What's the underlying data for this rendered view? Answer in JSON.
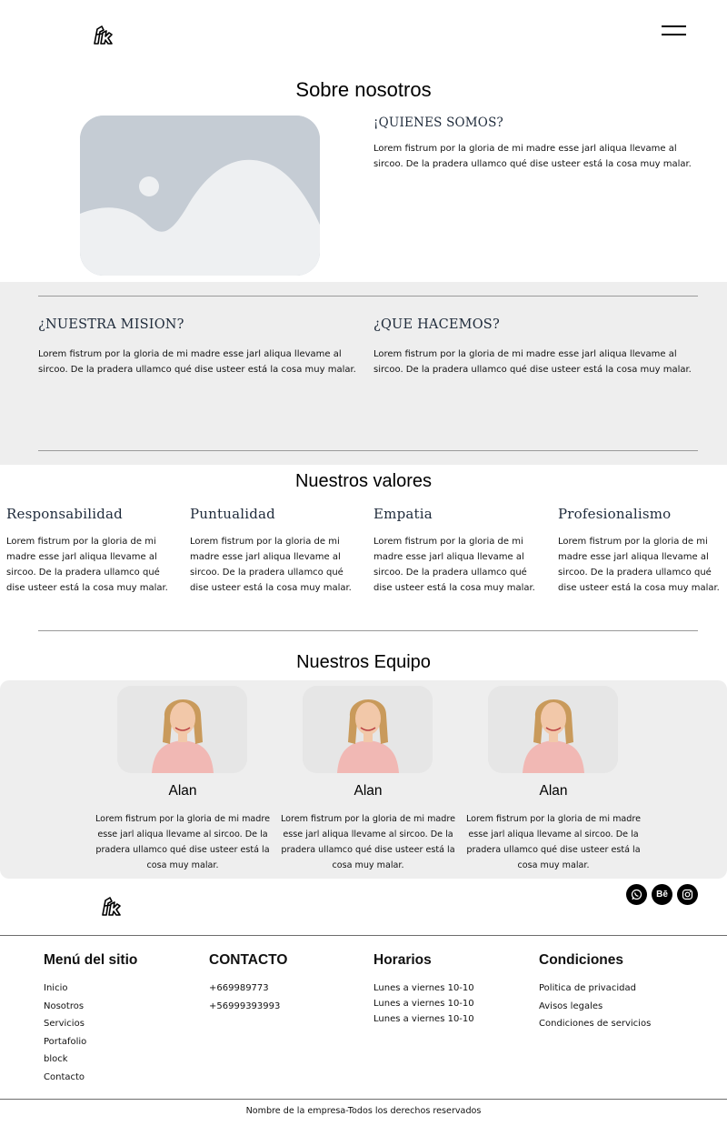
{
  "header": {
    "logo_icon": "brand-logo-icon",
    "menu_icon": "hamburger-menu-icon"
  },
  "about": {
    "title": "Sobre nosotros",
    "image_icon": "image-placeholder-icon",
    "who": {
      "heading": "¡QUIENES SOMOS?",
      "text": "Lorem fistrum por la gloria de mi madre esse jarl aliqua llevame al sircoo. De la pradera ullamco qué dise usteer está la cosa muy malar."
    },
    "mission": {
      "heading": "¿NUESTRA MISION?",
      "text": "Lorem fistrum por la gloria de mi madre esse jarl aliqua llevame al sircoo. De la pradera ullamco qué dise usteer está la cosa muy malar."
    },
    "what": {
      "heading": "¿QUE HACEMOS?",
      "text": "Lorem fistrum por la gloria de mi madre esse jarl aliqua llevame al sircoo. De la pradera ullamco qué dise usteer está la cosa muy malar."
    }
  },
  "values": {
    "title": "Nuestros valores",
    "items": [
      {
        "heading": "Responsabilidad",
        "text": "Lorem fistrum por la gloria de mi madre esse jarl aliqua llevame al sircoo. De la pradera ullamco qué dise usteer está la cosa muy malar."
      },
      {
        "heading": "Puntualidad",
        "text": "Lorem fistrum por la gloria de mi madre esse jarl aliqua llevame al sircoo. De la pradera ullamco qué dise usteer está la cosa muy malar."
      },
      {
        "heading": "Empatia",
        "text": "Lorem fistrum por la gloria de mi madre esse jarl aliqua llevame al sircoo. De la pradera ullamco qué dise usteer está la cosa muy malar."
      },
      {
        "heading": "Profesionalismo",
        "text": "Lorem fistrum por la gloria de mi madre esse jarl aliqua llevame al sircoo. De la pradera ullamco qué dise usteer está la cosa muy malar."
      }
    ]
  },
  "team": {
    "title": "Nuestros Equipo",
    "members": [
      {
        "name": "Alan",
        "text": "Lorem fistrum por la gloria de mi madre esse jarl aliqua llevame al sircoo. De la pradera ullamco qué dise usteer está la cosa muy malar."
      },
      {
        "name": "Alan",
        "text": "Lorem fistrum por la gloria de mi madre esse jarl aliqua llevame al sircoo. De la pradera ullamco qué dise usteer está la cosa muy malar."
      },
      {
        "name": "Alan",
        "text": "Lorem fistrum por la gloria de mi madre esse jarl aliqua llevame al sircoo. De la pradera ullamco qué dise usteer está la cosa muy malar."
      }
    ]
  },
  "social": {
    "whatsapp_icon": "whatsapp-icon",
    "behance_label": "Bē",
    "instagram_icon": "instagram-icon"
  },
  "footer": {
    "menu": {
      "heading": "Menú del sitio",
      "items": [
        "Inicio",
        "Nosotros",
        "Servicios",
        "Portafolio",
        "block",
        "Contacto"
      ]
    },
    "contact": {
      "heading": "CONTACTO",
      "items": [
        "+669989773",
        "+56999393993"
      ]
    },
    "hours": {
      "heading": "Horarios",
      "items": [
        "Lunes a viernes 10-10",
        "Lunes a viernes 10-10",
        "Lunes a viernes 10-10"
      ]
    },
    "conditions": {
      "heading": "Condiciones",
      "items": [
        "Politica de privacidad",
        "Avisos legales",
        "Condiciones de servicios"
      ]
    },
    "copyright": "Nombre de la empresa-Todos los derechos reservados"
  },
  "colors": {
    "band_gray": "#eeeeee",
    "heading_navy": "#1e2a3a",
    "image_placeholder": "#c5ccd4"
  }
}
